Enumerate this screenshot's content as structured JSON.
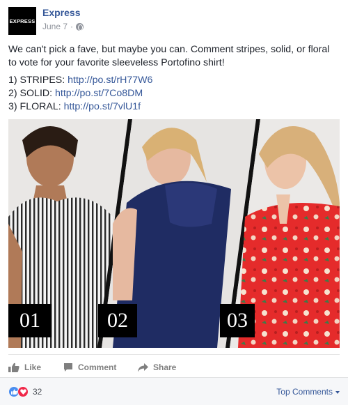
{
  "post": {
    "page_name": "Express",
    "avatar_text": "EXPRESS",
    "date": "June 7",
    "date_sep": "·",
    "privacy_icon": "globe-icon",
    "body": "We can't pick a fave, but maybe you can. Comment stripes, solid, or floral to vote for your favorite sleeveless Portofino shirt!",
    "options": [
      {
        "label": "1) STRIPES: ",
        "link": "http://po.st/rH77W6"
      },
      {
        "label": "2) SOLID: ",
        "link": "http://po.st/7Co8DM"
      },
      {
        "label": "3) FLORAL: ",
        "link": "http://po.st/7vlU1f"
      }
    ]
  },
  "image": {
    "panels": [
      "01",
      "02",
      "03"
    ]
  },
  "actions": {
    "like": "Like",
    "comment": "Comment",
    "share": "Share"
  },
  "footer": {
    "reaction_count": "32",
    "top_comments": "Top Comments",
    "reaction_icons": [
      "like-reaction-icon",
      "love-reaction-icon"
    ]
  },
  "colors": {
    "link": "#365899",
    "meta": "#90949c",
    "like_reaction": "#4a8ef0",
    "love_reaction": "#f0284a"
  }
}
